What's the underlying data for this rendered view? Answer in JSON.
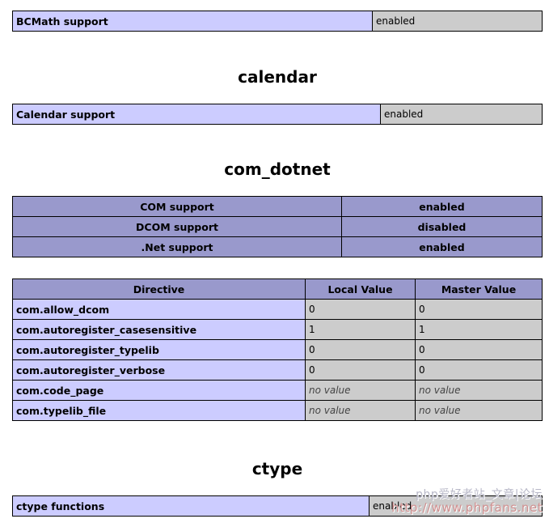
{
  "bcmath": {
    "rows": [
      {
        "name": "BCMath support",
        "value": "enabled"
      }
    ]
  },
  "calendar": {
    "heading": "calendar",
    "rows": [
      {
        "name": "Calendar support",
        "value": "enabled"
      }
    ]
  },
  "com_dotnet": {
    "heading": "com_dotnet",
    "support_rows": [
      {
        "name": "COM support",
        "value": "enabled"
      },
      {
        "name": "DCOM support",
        "value": "disabled"
      },
      {
        "name": ".Net support",
        "value": "enabled"
      }
    ],
    "directive_headers": {
      "directive": "Directive",
      "local": "Local Value",
      "master": "Master Value"
    },
    "directives": [
      {
        "name": "com.allow_dcom",
        "local": "0",
        "master": "0"
      },
      {
        "name": "com.autoregister_casesensitive",
        "local": "1",
        "master": "1"
      },
      {
        "name": "com.autoregister_typelib",
        "local": "0",
        "master": "0"
      },
      {
        "name": "com.autoregister_verbose",
        "local": "0",
        "master": "0"
      },
      {
        "name": "com.code_page",
        "local": "no value",
        "master": "no value"
      },
      {
        "name": "com.typelib_file",
        "local": "no value",
        "master": "no value"
      }
    ]
  },
  "ctype": {
    "heading": "ctype",
    "rows": [
      {
        "name": "ctype functions",
        "value": "enabled"
      }
    ]
  },
  "watermark": {
    "line1": "php爱好者站_文章|论坛",
    "line2": "http://www.phpfans.net"
  },
  "colors": {
    "header_bg": "#9999cc",
    "name_bg": "#ccccff",
    "value_bg": "#cccccc",
    "border": "#000000"
  }
}
